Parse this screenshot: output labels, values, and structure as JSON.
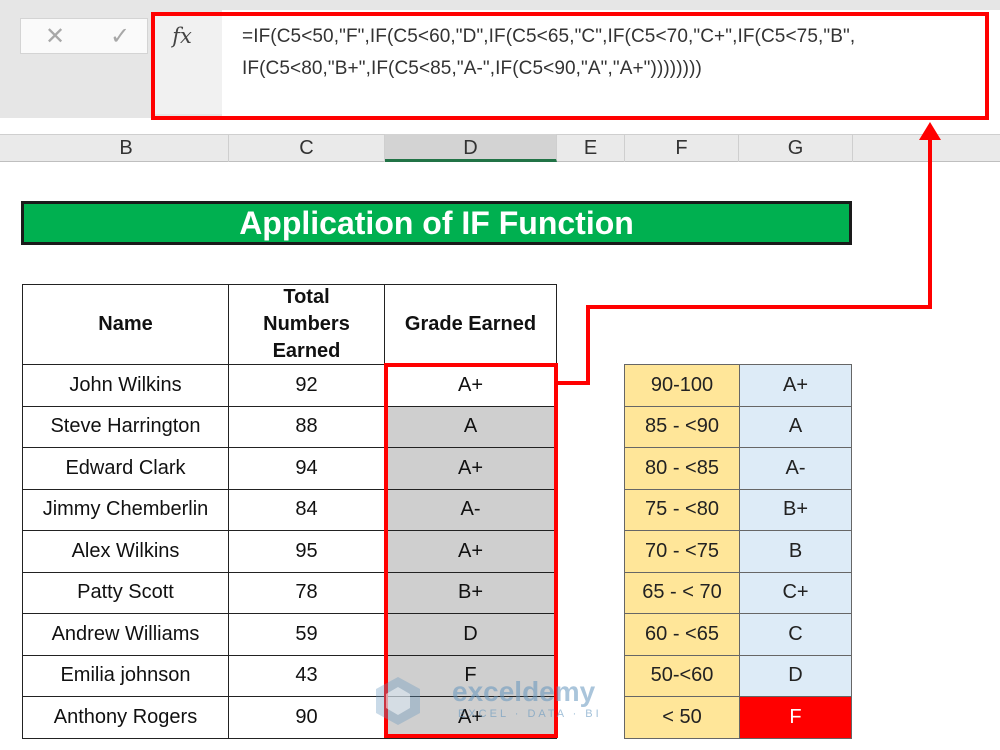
{
  "formula_bar": {
    "cancel_icon": "x-icon",
    "enter_icon": "check-icon",
    "fx_label": "fx",
    "formula_line1": "=IF(C5<50,\"F\",IF(C5<60,\"D\",IF(C5<65,\"C\",IF(C5<70,\"C+\",IF(C5<75,\"B\",",
    "formula_line2": "IF(C5<80,\"B+\",IF(C5<85,\"A-\",IF(C5<90,\"A\",\"A+\"))))))))"
  },
  "columns": [
    "B",
    "C",
    "D",
    "E",
    "F",
    "G"
  ],
  "selected_column": "D",
  "title": "Application of IF Function",
  "table": {
    "headers": {
      "name": "Name",
      "total_l1": "Total",
      "total_l2": "Numbers",
      "total_l3": "Earned",
      "grade": "Grade Earned"
    },
    "rows": [
      {
        "name": "John Wilkins",
        "score": "92",
        "grade": "A+"
      },
      {
        "name": "Steve Harrington",
        "score": "88",
        "grade": "A"
      },
      {
        "name": "Edward Clark",
        "score": "94",
        "grade": "A+"
      },
      {
        "name": "Jimmy Chemberlin",
        "score": "84",
        "grade": "A-"
      },
      {
        "name": "Alex Wilkins",
        "score": "95",
        "grade": "A+"
      },
      {
        "name": "Patty Scott",
        "score": "78",
        "grade": "B+"
      },
      {
        "name": "Andrew Williams",
        "score": "59",
        "grade": "D"
      },
      {
        "name": "Emilia johnson",
        "score": "43",
        "grade": "F"
      },
      {
        "name": "Anthony Rogers",
        "score": "90",
        "grade": "A+"
      }
    ]
  },
  "grade_scale": [
    {
      "range": "90-100",
      "grade": "A+"
    },
    {
      "range": "85 - <90",
      "grade": "A"
    },
    {
      "range": "80 - <85",
      "grade": "A-"
    },
    {
      "range": "75 - <80",
      "grade": "B+"
    },
    {
      "range": "70 - <75",
      "grade": "B"
    },
    {
      "range": "65 - < 70",
      "grade": "C+"
    },
    {
      "range": "60 - <65",
      "grade": "C"
    },
    {
      "range": "50-<60",
      "grade": "D"
    },
    {
      "range": "< 50",
      "grade": "F"
    }
  ],
  "watermark": {
    "brand": "exceldemy",
    "tagline": "EXCEL · DATA · BI"
  },
  "colors": {
    "banner": "#00b050",
    "highlight": "#ff0000",
    "range_fill": "#ffe699",
    "grade_fill": "#ddebf7",
    "selected_fill": "#cfcfcf"
  }
}
